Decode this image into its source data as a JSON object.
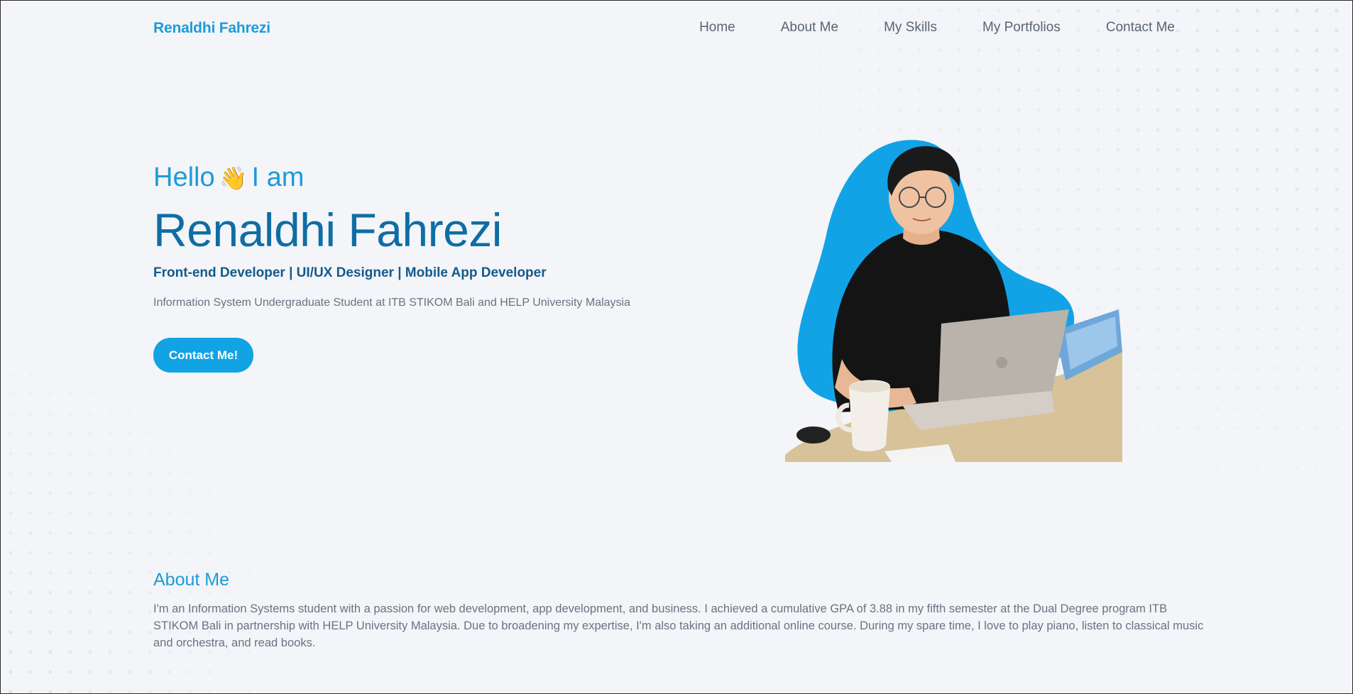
{
  "brand": "Renaldhi Fahrezi",
  "nav": {
    "items": [
      {
        "label": "Home"
      },
      {
        "label": "About Me"
      },
      {
        "label": "My Skills"
      },
      {
        "label": "My Portfolios"
      },
      {
        "label": "Contact Me"
      }
    ]
  },
  "hero": {
    "greeting": "Hello",
    "wave_emoji": "👋",
    "greeting_suffix": "I am",
    "name": "Renaldhi Fahrezi",
    "roles": "Front-end Developer | UI/UX Designer | Mobile App Developer",
    "description": "Information System Undergraduate Student at ITB STIKOM Bali and HELP University Malaysia",
    "cta_label": "Contact Me!"
  },
  "about": {
    "title": "About Me",
    "text": "I'm an Information Systems student with a passion for web development, app development, and business. I achieved a cumulative GPA of 3.88 in my fifth semester at the Dual Degree program ITB STIKOM Bali in partnership with HELP University Malaysia. Due to broadening my expertise, I'm also taking an additional online course. During my spare time, I love to play piano, listen to classical music and orchestra, and read books."
  },
  "colors": {
    "accent": "#1e9ad8",
    "name": "#0f6da4",
    "roles": "#145a8c",
    "button": "#11a3e4",
    "blob": "#12a3e6",
    "background": "#f3f5f8"
  },
  "icons": {
    "wave": "waving-hand-icon"
  }
}
